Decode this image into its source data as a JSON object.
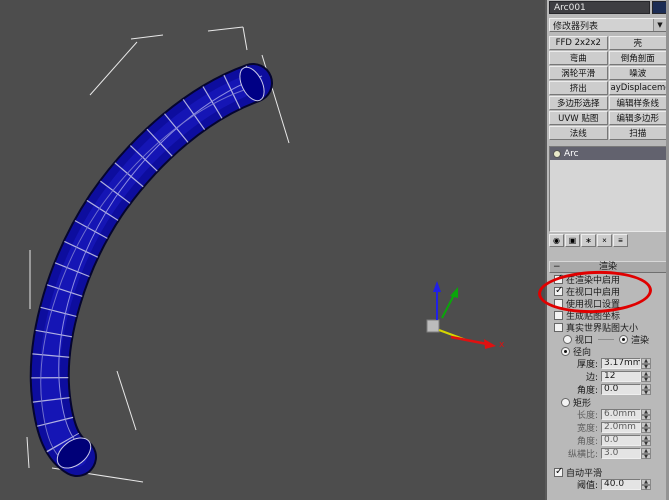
{
  "viewport": {
    "axis_x_label": "x"
  },
  "panel": {
    "object_name": "Arc001",
    "modifier_list_label": "修改器列表",
    "modifier_buttons": [
      "FFD 2x2x2",
      "壳",
      "弯曲",
      "倒角剖面",
      "涡轮平滑",
      "噪波",
      "挤出",
      "ayDisplacement",
      "多边形选择",
      "编辑样条线",
      "UVW 贴图",
      "编辑多边形",
      "法线",
      "扫描"
    ],
    "stack_items": [
      {
        "label": "Arc",
        "selected": true
      }
    ],
    "stack_tools": [
      {
        "name": "pin-stack",
        "glyph": "◉"
      },
      {
        "name": "show-end-result",
        "glyph": "▣"
      },
      {
        "name": "make-unique",
        "glyph": "∗"
      },
      {
        "name": "remove-modifier",
        "glyph": "×"
      },
      {
        "name": "configure-modifier-sets",
        "glyph": "≡"
      }
    ],
    "rendering": {
      "collapse": "−",
      "title": "渲染",
      "checks": [
        {
          "label": "在渲染中启用",
          "checked": true
        },
        {
          "label": "在视口中启用",
          "checked": true
        },
        {
          "label": "使用视口设置",
          "checked": false
        },
        {
          "label": "生成贴图坐标",
          "checked": false
        },
        {
          "label": "真实世界贴图大小",
          "checked": false
        }
      ],
      "mode_radios": [
        {
          "label": "视口",
          "selected": false
        },
        {
          "label": "渲染",
          "selected": true
        }
      ],
      "radial_label": "径向",
      "radial_selected": true,
      "radial_params": [
        {
          "label": "厚度:",
          "value": "3.17mm"
        },
        {
          "label": "边:",
          "value": "12"
        },
        {
          "label": "角度:",
          "value": "0.0"
        }
      ],
      "rect_label": "矩形",
      "rect_selected": false,
      "rect_params": [
        {
          "label": "长度:",
          "value": "6.0mm"
        },
        {
          "label": "宽度:",
          "value": "2.0mm"
        },
        {
          "label": "角度:",
          "value": "0.0"
        },
        {
          "label": "纵横比:",
          "value": "3.0"
        }
      ],
      "auto_smooth": {
        "label": "自动平滑",
        "checked": true
      },
      "threshold": {
        "label": "阈值:",
        "value": "40.0"
      }
    }
  },
  "annotation": {
    "color": "#e00000"
  }
}
